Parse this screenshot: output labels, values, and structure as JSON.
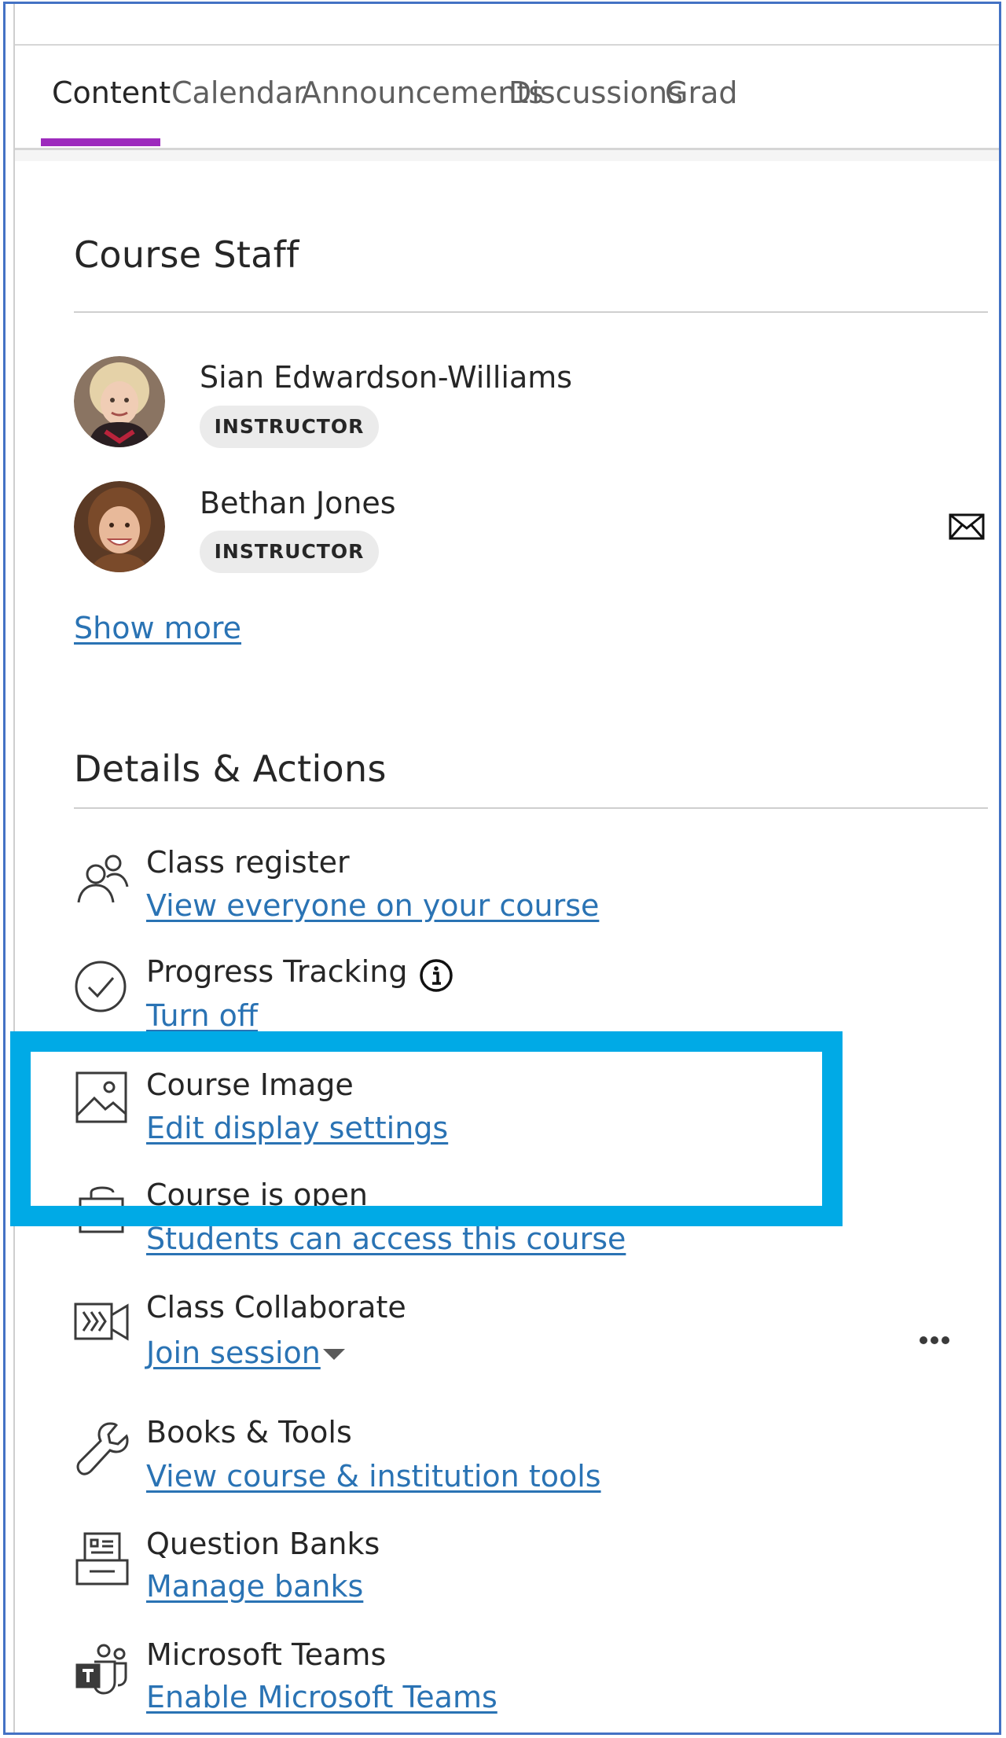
{
  "tabs": [
    {
      "label": "Content",
      "active": true
    },
    {
      "label": "Calendar"
    },
    {
      "label": "Announcements"
    },
    {
      "label": "Discussions"
    },
    {
      "label": "Grad"
    }
  ],
  "staff": {
    "title": "Course Staff",
    "members": [
      {
        "name": "Sian Edwardson-Williams",
        "role": "INSTRUCTOR"
      },
      {
        "name": "Bethan Jones",
        "role": "INSTRUCTOR"
      }
    ],
    "show_more": "Show more"
  },
  "details": {
    "title": "Details & Actions",
    "items": [
      {
        "title": "Class register",
        "link": "View everyone on your course",
        "icon": "people-icon"
      },
      {
        "title": "Progress Tracking",
        "link": "Turn off",
        "icon": "checkmark-circle-icon"
      },
      {
        "title": "Course Image",
        "link": "Edit display settings",
        "icon": "image-icon"
      },
      {
        "title": "Course is open",
        "link": "Students can access this course",
        "icon": "lock-icon"
      },
      {
        "title": "Class Collaborate",
        "link": "Join session",
        "icon": "video-camera-icon"
      },
      {
        "title": "Books & Tools",
        "link": "View course & institution tools",
        "icon": "wrench-icon"
      },
      {
        "title": "Question Banks",
        "link": "Manage banks",
        "icon": "question-bank-icon"
      },
      {
        "title": "Microsoft Teams",
        "link": "Enable Microsoft Teams",
        "icon": "teams-icon"
      }
    ]
  },
  "colors": {
    "tab_active_underline": "#9d2bbd",
    "link": "#2a73b4",
    "highlight_box": "#00aae6",
    "frame_border": "#4472c4"
  }
}
